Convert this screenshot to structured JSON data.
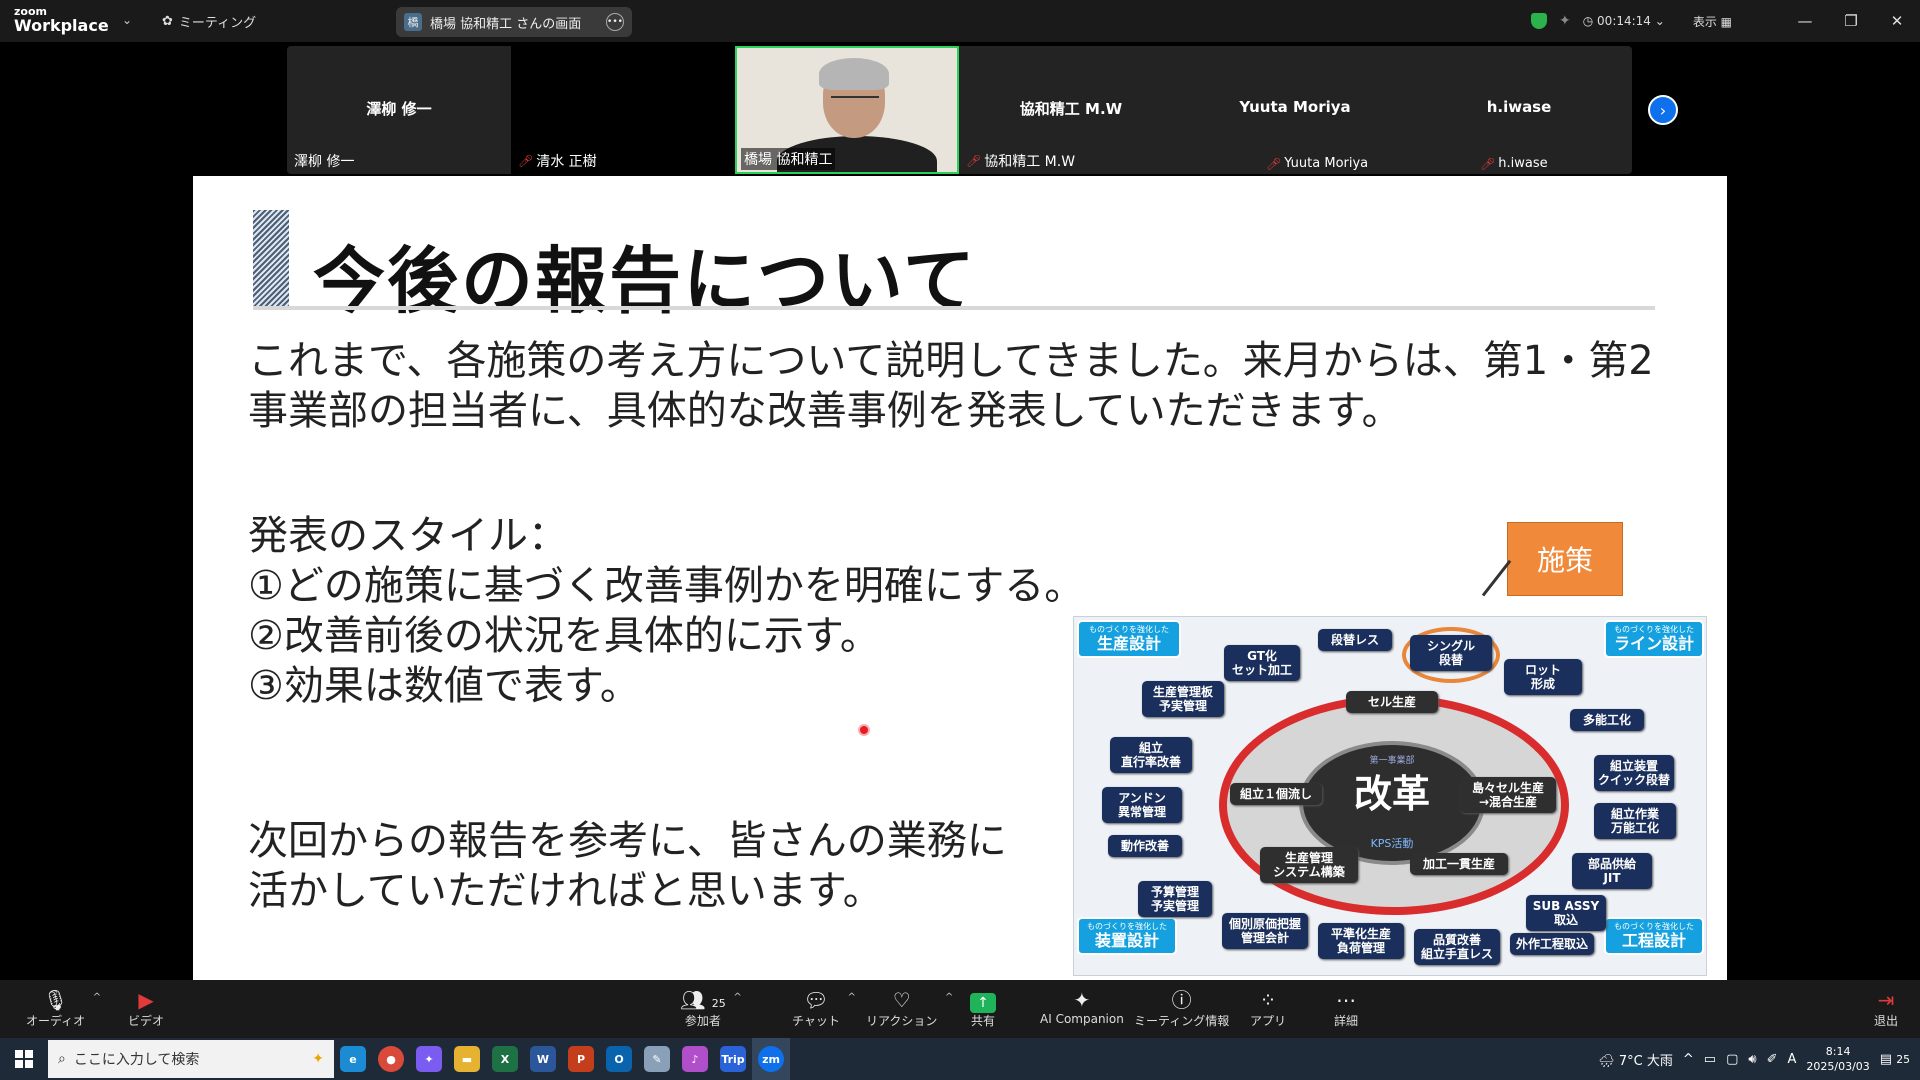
{
  "app": {
    "logo_small": "zoom",
    "logo_big": "Workplace",
    "meeting_label": "ミーティング",
    "share_tab_initial": "橋",
    "share_tab_label": "橋場 協和精工 さんの画面",
    "timer": "00:14:14",
    "view_label": "表示"
  },
  "participants": [
    {
      "center_name": "澤柳 修一",
      "tag": "澤柳 修一",
      "muted": false
    },
    {
      "center_name": "",
      "tag": "清水 正樹",
      "muted": true
    },
    {
      "center_name": "",
      "tag": "橋場 協和精工",
      "muted": false
    },
    {
      "center_name": "協和精工 M.W",
      "tag": "協和精工 M.W",
      "muted": true
    },
    {
      "center_name": "Yuuta Moriya",
      "tag": "Yuuta Moriya",
      "muted": true
    },
    {
      "center_name": "h.iwase",
      "tag": "h.iwase",
      "muted": true
    }
  ],
  "slide": {
    "title": "今後の報告について",
    "para1": "これまで、各施策の考え方について説明してきました。来月からは、第1・第2事業部の担当者に、具体的な改善事例を発表していただきます。",
    "style_heading": "発表のスタイル：",
    "style_1": "①どの施策に基づく改善事例かを明確にする。",
    "style_2": "②改善前後の状況を具体的に示す。",
    "style_3": "③効果は数値で表す。",
    "closing_1": "次回からの報告を参考に、皆さんの業務に",
    "closing_2": "活かしていただければと思います。",
    "callout": "施策",
    "diagram": {
      "core": "改革",
      "core_top": "第一事業部",
      "core_sub": "KPS活動",
      "corner_tl": "生産設計",
      "corner_tl_tiny": "ものづくりを強化した",
      "corner_tr": "ライン設計",
      "corner_tr_tiny": "ものづくりを強化した",
      "corner_bl": "装置設計",
      "corner_bl_tiny": "ものづくりを強化した",
      "corner_br": "工程設計",
      "corner_br_tiny": "ものづくりを強化した",
      "nodes": {
        "gt": "GT化\nセット加工",
        "danless": "段替レス",
        "single": "シングル\n段替",
        "lot": "ロット\n形成",
        "kanban": "生産管理板\n予実管理",
        "cell": "セル生産",
        "tanou": "多能工化",
        "kumitate": "組立\n直行率改善",
        "quick": "組立装置\nクイック段替",
        "andon": "アンドン\n異常管理",
        "ikko": "組立１個流し",
        "konryu": "島々セル生産\n→混合生産",
        "banno": "組立作業\n万能工化",
        "dousa": "動作改善",
        "system": "生産管理\nシステム構築",
        "ikkan": "加工一貫生産",
        "jit": "部品供給\nJIT",
        "yosan": "予算管理\n予実管理",
        "sub": "SUB ASSY\n取込",
        "genka": "個別原価把握\n管理会計",
        "heijun": "平準化生産\n負荷管理",
        "hinshitsu": "品質改善\n組立手直レス",
        "gaisaku": "外作工程取込"
      }
    }
  },
  "toolbar": {
    "audio": "オーディオ",
    "video": "ビデオ",
    "participants": "参加者",
    "participants_count": "25",
    "chat": "チャット",
    "reaction": "リアクション",
    "share": "共有",
    "ai": "AI Companion",
    "info": "ミーティング情報",
    "apps": "アプリ",
    "more": "詳細",
    "leave": "退出"
  },
  "taskbar": {
    "search_placeholder": "ここに入力して検索",
    "weather": "7°C 大雨",
    "time": "8:14",
    "date": "2025/03/03",
    "ime": "A",
    "notif_count": "25"
  }
}
